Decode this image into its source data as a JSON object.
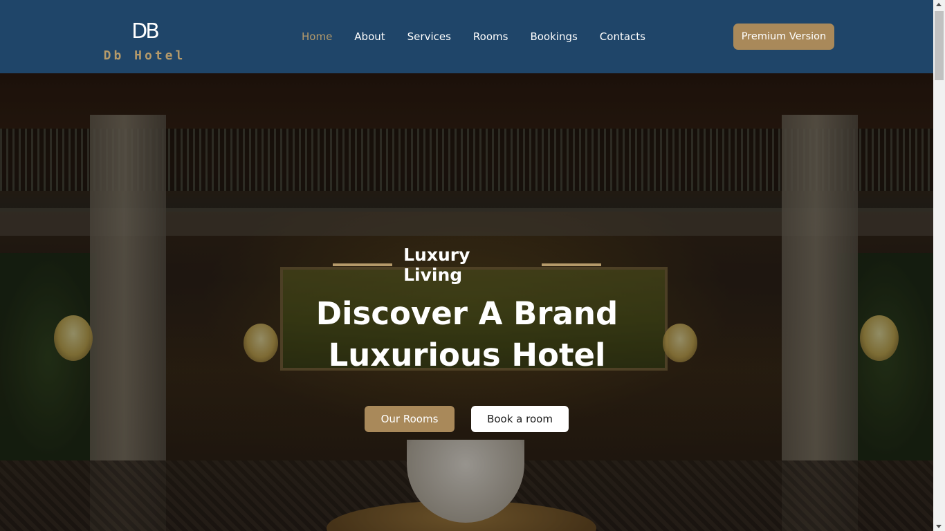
{
  "brand": {
    "mark": "DB",
    "name": "Db Hotel"
  },
  "nav": {
    "items": [
      {
        "label": "Home",
        "active": true
      },
      {
        "label": "About",
        "active": false
      },
      {
        "label": "Services",
        "active": false
      },
      {
        "label": "Rooms",
        "active": false
      },
      {
        "label": "Bookings",
        "active": false
      },
      {
        "label": "Contacts",
        "active": false
      }
    ],
    "premium_label": "Premium Version"
  },
  "hero": {
    "subtitle": "Luxury Living",
    "title_line1": "Discover A Brand",
    "title_line2": "Luxurious Hotel",
    "primary_button": "Our Rooms",
    "secondary_button": "Book a room"
  },
  "colors": {
    "navbar_bg": "#1f4569",
    "accent_gold": "#a9895a",
    "active_link": "#b59a6a"
  }
}
